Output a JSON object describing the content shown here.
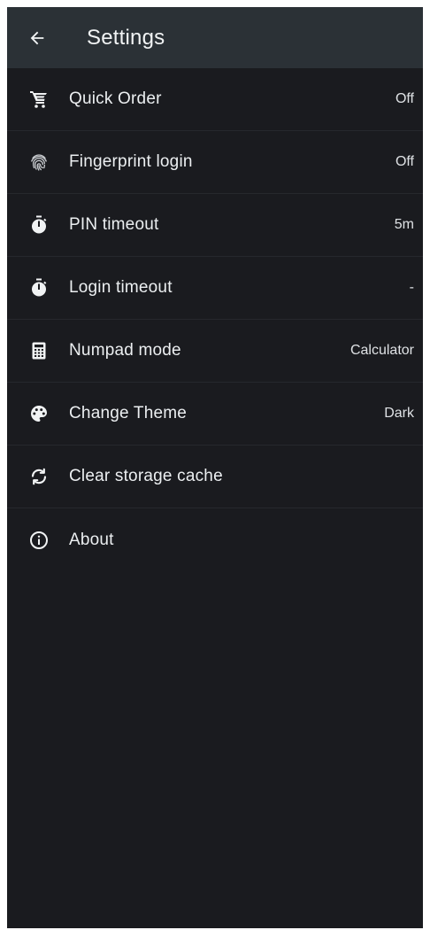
{
  "colors": {
    "appbar_bg": "#2b3136",
    "screen_bg": "#1a1b1f",
    "divider": "#26282d",
    "text": "#eceff1"
  },
  "appbar": {
    "back_icon": "arrow-back-icon",
    "title": "Settings"
  },
  "settings": [
    {
      "icon": "cart-icon",
      "label": "Quick Order",
      "value": "Off"
    },
    {
      "icon": "fingerprint-icon",
      "label": "Fingerprint login",
      "value": "Off"
    },
    {
      "icon": "timer-icon",
      "label": "PIN timeout",
      "value": "5m"
    },
    {
      "icon": "timer-icon",
      "label": "Login timeout",
      "value": "-"
    },
    {
      "icon": "calculator-icon",
      "label": "Numpad mode",
      "value": "Calculator"
    },
    {
      "icon": "palette-icon",
      "label": "Change Theme",
      "value": "Dark"
    },
    {
      "icon": "sync-icon",
      "label": "Clear storage cache",
      "value": ""
    },
    {
      "icon": "info-icon",
      "label": "About",
      "value": ""
    }
  ]
}
